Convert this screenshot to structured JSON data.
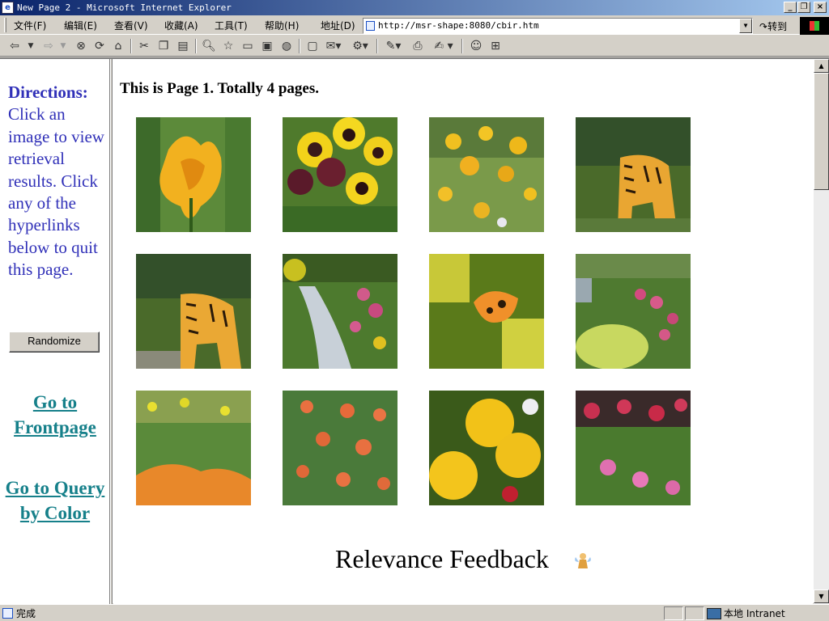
{
  "window": {
    "title": "New Page 2 - Microsoft Internet Explorer",
    "app_icon": "ie-icon"
  },
  "menu": [
    "文件(F)",
    "编辑(E)",
    "查看(V)",
    "收藏(A)",
    "工具(T)",
    "帮助(H)"
  ],
  "address": {
    "label": "地址(D)",
    "url": "http://msr-shape:8080/cbir.htm",
    "go_label": "转到"
  },
  "toolbar_icons": [
    "back-icon",
    "dropdown-icon",
    "forward-icon",
    "dropdown-icon",
    "stop-icon",
    "refresh-icon",
    "home-icon",
    "cut-icon",
    "copy-icon",
    "paste-icon",
    "search-icon",
    "favorites-icon",
    "history-icon",
    "folders-icon",
    "media-icon",
    "fullscreen-icon",
    "mail-icon",
    "encoding-icon",
    "edit-icon",
    "print-icon",
    "discuss-icon",
    "messenger-icon",
    "research-icon"
  ],
  "sidebar": {
    "directions_title": "Directions:",
    "directions_text": "Click an image to view retrieval results. Click any of the hyperlinks below to quit this page.",
    "randomize_label": "Randomize",
    "link_frontpage": "Go to Frontpage",
    "link_query_color": "Go to Query by Color",
    "text_color": "#3030b8",
    "link_color": "#16808a"
  },
  "main": {
    "page_info": "This is Page 1. Totally 4 pages.",
    "images": [
      {
        "name": "yellow-iris-image",
        "subject": "yellow iris"
      },
      {
        "name": "pansies-image",
        "subject": "pansies"
      },
      {
        "name": "wildflowers-image",
        "subject": "yellow wildflowers"
      },
      {
        "name": "tiger-image-1",
        "subject": "tiger"
      },
      {
        "name": "tiger-image-2",
        "subject": "tiger"
      },
      {
        "name": "garden-stream-image",
        "subject": "garden stream"
      },
      {
        "name": "butterfly-image",
        "subject": "butterfly"
      },
      {
        "name": "garden-border-image",
        "subject": "garden border"
      },
      {
        "name": "orange-flowers-image",
        "subject": "orange flowers"
      },
      {
        "name": "orange-lilies-image",
        "subject": "orange lilies"
      },
      {
        "name": "yellow-poppies-image",
        "subject": "yellow poppies"
      },
      {
        "name": "pink-primula-image",
        "subject": "pink primula"
      }
    ],
    "feedback_label": "Relevance Feedback",
    "feedback_icon": "fairy-icon"
  },
  "status": {
    "text": "完成",
    "zone": "本地 Intranet",
    "zone_icon": "local-intranet-icon"
  }
}
